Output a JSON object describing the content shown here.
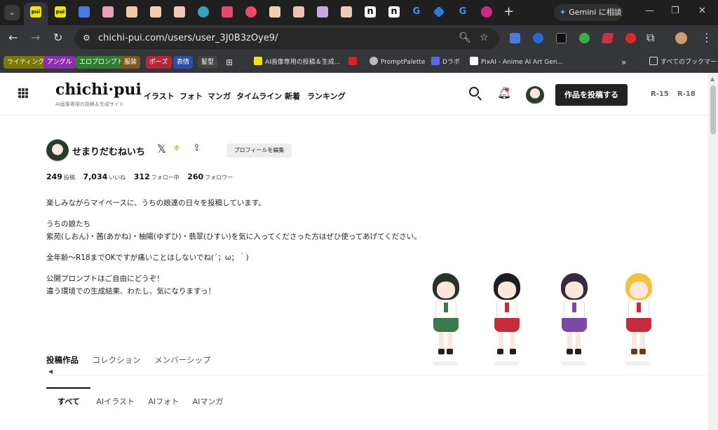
{
  "browser": {
    "tab_favicon_text": "pui",
    "tab_n_text": "n",
    "tab_g_text": "G",
    "new_tab": "+",
    "gemini_label": "Gemini に相談",
    "url": "chichi-pui.com/users/user_3J0B3zOye9/",
    "bookmarks": [
      {
        "label": "ライティング",
        "color": "#7a7a00"
      },
      {
        "label": "アングル",
        "color": "#8b2fb0"
      },
      {
        "label": "エロプロンプト",
        "color": "#2f7d32"
      },
      {
        "label": "服装",
        "color": "#7a5a1a"
      },
      {
        "label": "ポーズ",
        "color": "#b0283a"
      },
      {
        "label": "表情",
        "color": "#2a4fa8"
      },
      {
        "label": "髪型",
        "color": "#444444"
      }
    ],
    "bookmark_links": [
      "AI画像専用の投稿＆生成...",
      "PromptPalette",
      "Dラボ",
      "PixAI - Anime AI Art Gen..."
    ],
    "bookmarks_more": "»",
    "all_bookmarks": "すべてのブックマーク"
  },
  "header": {
    "logo": "chichi·pui",
    "logo_sub": "AI画像専用の投稿＆生成サイト",
    "nav": [
      "イラスト",
      "フォト",
      "マンガ",
      "タイムライン",
      "新着",
      "ランキング"
    ],
    "post_button": "作品を投稿する",
    "rating_r15": "R-15",
    "rating_r18": "R-18"
  },
  "profile": {
    "name": "せまりだむねいち",
    "edit_button": "プロフィールを編集",
    "stats": [
      {
        "value": "249",
        "label": "投稿"
      },
      {
        "value": "7,034",
        "label": "いいね"
      },
      {
        "value": "312",
        "label": "フォロー中"
      },
      {
        "value": "260",
        "label": "フォロワー"
      }
    ],
    "bio": [
      "楽しみながらマイペースに、うちの娘達の日々を投稿しています。",
      "うちの娘たち",
      "紫苑(しおん)・茜(あかね)・柚陽(ゆずひ)・翡翠(ひすい)を気に入ってくださった方はぜひ使ってあげてください。",
      "全年齢〜R18までOKですが痛いことはしないでね(´；ω；｀)",
      "公開プロンプトはご自由にどうぞ！",
      "違う環境での生成結果、わたし、気になりますっ！"
    ]
  },
  "characters": [
    {
      "hair": "#2b3328",
      "skirt": "#3b7a4a",
      "tie": "#3b7a4a"
    },
    {
      "hair": "#1e1e22",
      "skirt": "#c62b3b",
      "tie": "#c62b3b"
    },
    {
      "hair": "#3a2a40",
      "skirt": "#7b4aa8",
      "tie": "#7b4aa8"
    },
    {
      "hair": "#f3c23a",
      "skirt": "#c62b3b",
      "tie": "#c62b3b"
    }
  ],
  "content_tabs": [
    "投稿作品",
    "コレクション",
    "メンバーシップ"
  ],
  "sub_tabs": [
    "すべて",
    "AIイラスト",
    "AIフォト",
    "AIマンガ"
  ]
}
